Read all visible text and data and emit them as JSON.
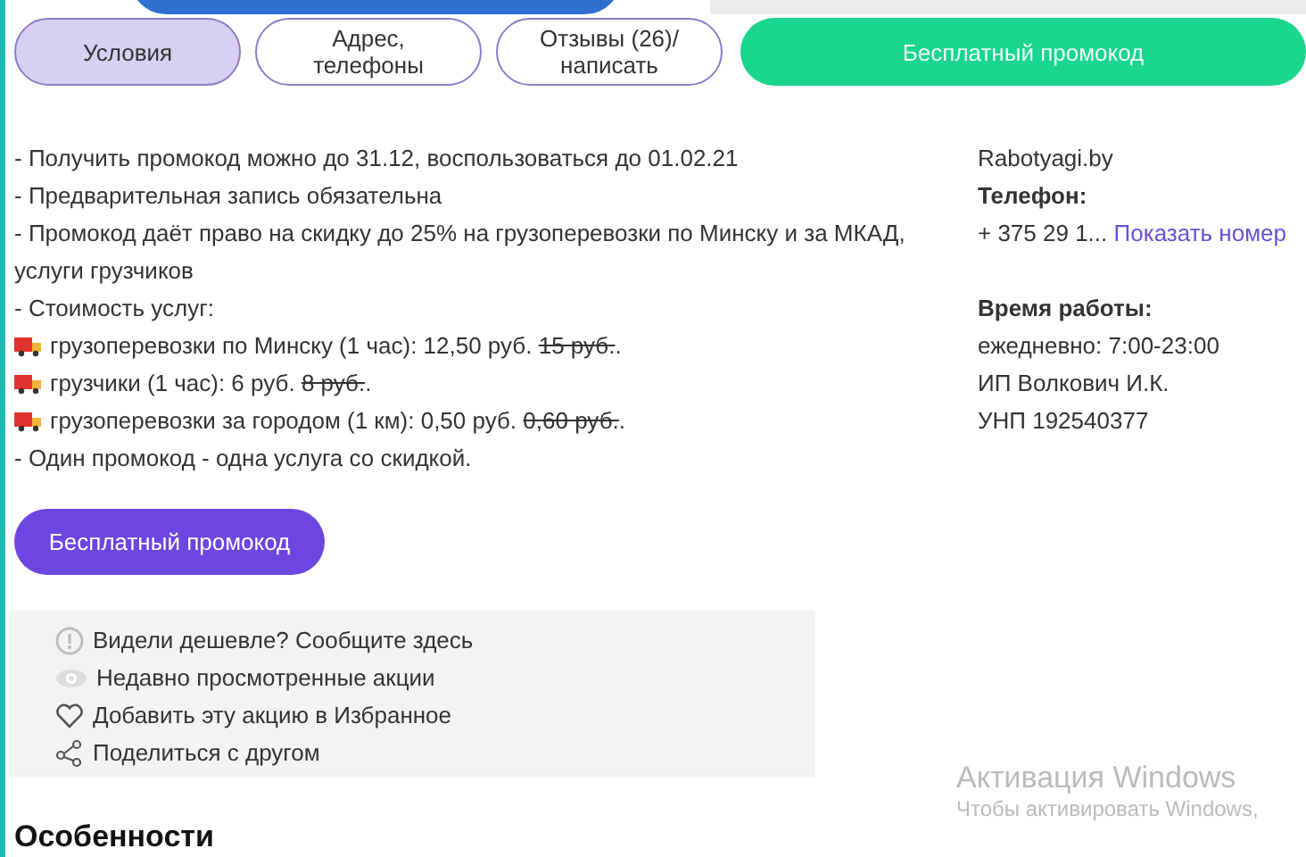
{
  "tabs": [
    {
      "label": "Условия",
      "selected": true
    },
    {
      "label": "Адрес,\nтелефоны",
      "selected": false
    },
    {
      "label": "Отзывы (26)/\nнаписать",
      "selected": false
    }
  ],
  "promo_tab_button": "Бесплатный промокод",
  "conditions": [
    {
      "kind": "text",
      "text": "- Получить промокод можно до 31.12, воспользоваться до 01.02.21"
    },
    {
      "kind": "text",
      "text": "- Предварительная запись обязательна"
    },
    {
      "kind": "text",
      "text": "- Промокод даёт право на скидку до 25% на грузоперевозки по Минску и за МКАД, услуги грузчиков"
    },
    {
      "kind": "text",
      "text": "- Стоимость услуг:"
    },
    {
      "kind": "price",
      "text": "грузоперевозки по Минску (1 час): 12,50 руб.",
      "old_price": "15 руб.",
      "end": "."
    },
    {
      "kind": "price",
      "text": "грузчики (1 час): 6 руб.",
      "old_price": "8 руб.",
      "end": "."
    },
    {
      "kind": "price",
      "text": "грузоперевозки за городом (1 км): 0,50 руб.",
      "old_price": "0,60 руб.",
      "end": "."
    },
    {
      "kind": "text",
      "text": "- Один промокод - одна услуга со скидкой."
    }
  ],
  "promo_button": "Бесплатный промокод",
  "contacts": {
    "company": "Rabotyagi.by",
    "phone_label": "Телефон:",
    "phone": "+ 375 29 1...",
    "show_number": "Показать номер",
    "hours_label": "Время работы:",
    "hours": "ежедневно: 7:00-23:00",
    "owner": "ИП Волкович И.К.",
    "unp": "УНП 192540377"
  },
  "actions": [
    {
      "kind": "alert",
      "label": "Видели дешевле? Сообщите здесь"
    },
    {
      "kind": "eye",
      "label": "Недавно просмотренные акции"
    },
    {
      "kind": "heart",
      "label": "Добавить эту акцию в Избранное"
    },
    {
      "kind": "share",
      "label": "Поделиться с другом"
    }
  ],
  "features_heading": "Особенности",
  "os_notice": {
    "title": "Активация Windows",
    "text": "Чтобы активировать Windows,"
  }
}
